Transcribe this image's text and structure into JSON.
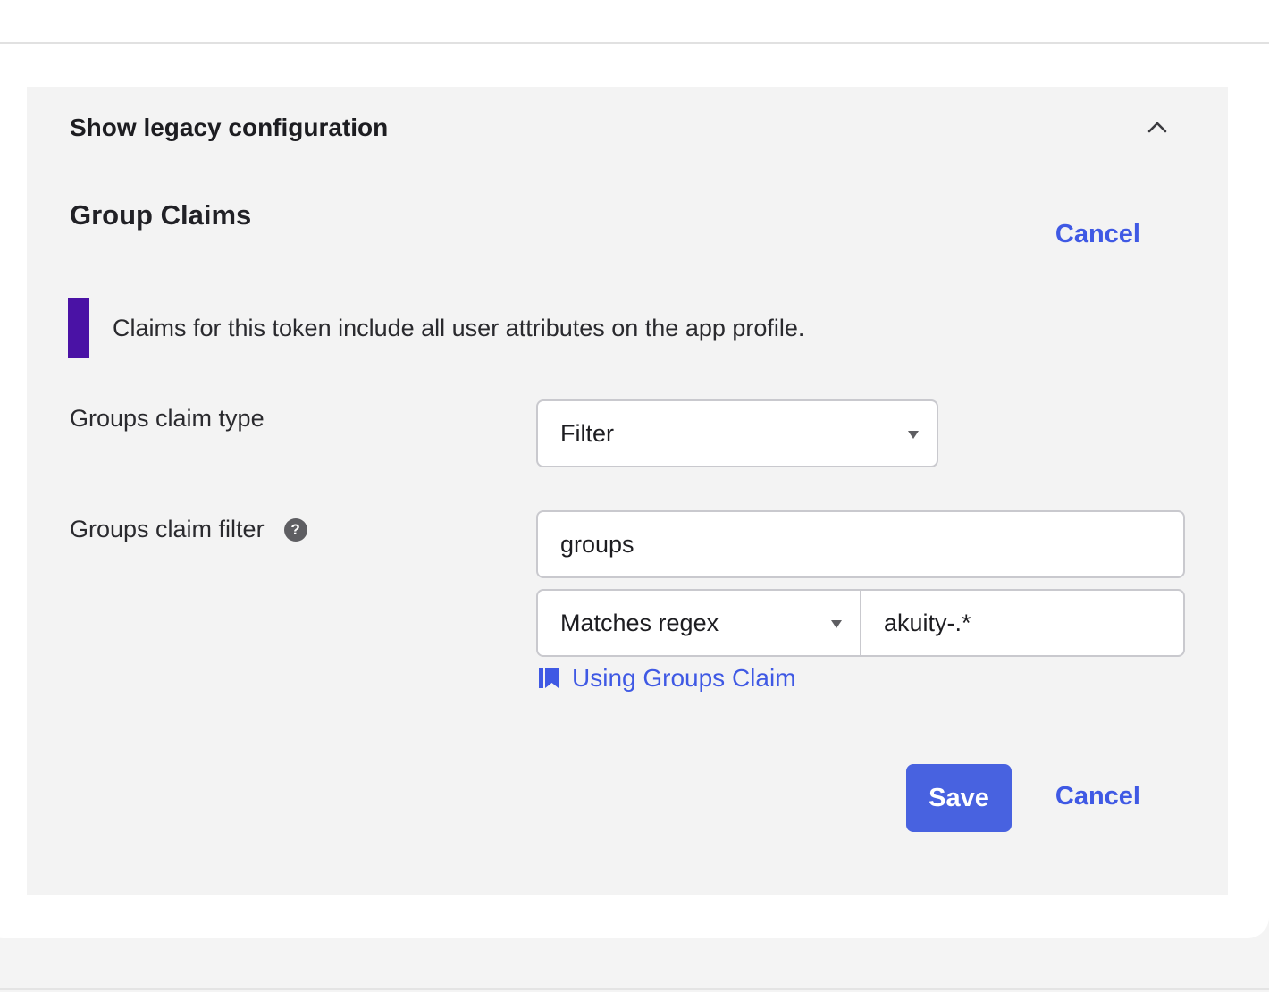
{
  "legacy": {
    "toggle_label": "Show legacy configuration",
    "expanded": true
  },
  "group_claims": {
    "title": "Group Claims",
    "cancel_top_label": "Cancel",
    "callout_text": "Claims for this token include all user attributes on the app profile.",
    "callout_color": "#4a12a5",
    "groups_claim_type": {
      "label": "Groups claim type",
      "selected": "Filter"
    },
    "groups_claim_filter": {
      "label": "Groups claim filter",
      "help_glyph": "?",
      "name_value": "groups",
      "operator_selected": "Matches regex",
      "pattern_value": "akuity-.*"
    },
    "doc_link_label": "Using Groups Claim",
    "save_label": "Save",
    "cancel_bottom_label": "Cancel"
  },
  "icons": {
    "toggle": "chevron-up-icon",
    "help": "help-icon",
    "doc": "book-icon"
  },
  "colors": {
    "accent": "#3f59e4",
    "primary_button": "#4862e0",
    "panel_bg": "#f3f3f3"
  }
}
